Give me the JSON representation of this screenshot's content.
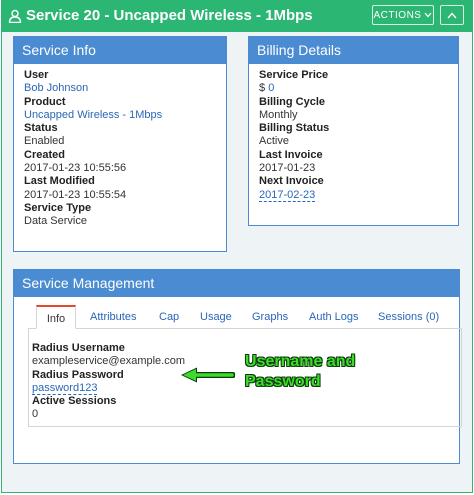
{
  "window": {
    "title": "Service 20 - Uncapped Wireless - 1Mbps",
    "actions_label": "ACTIONS",
    "accent_color": "#2bb673"
  },
  "service_info": {
    "heading": "Service Info",
    "fields": [
      {
        "label": "User",
        "value": "Bob Johnson"
      },
      {
        "label": "Product",
        "value": "Uncapped Wireless - 1Mbps"
      },
      {
        "label": "Status",
        "value": "Enabled"
      },
      {
        "label": "Created",
        "value": "2017-01-23 10:55:56"
      },
      {
        "label": "Last Modified",
        "value": "2017-01-23 10:55:54"
      },
      {
        "label": "Service Type",
        "value": "Data Service"
      }
    ]
  },
  "billing": {
    "heading": "Billing Details",
    "price_label": "Service Price",
    "price_currency": "$",
    "price_value": "0",
    "cycle_label": "Billing Cycle",
    "cycle_value": "Monthly",
    "status_label": "Billing Status",
    "status_value": "Active",
    "last_invoice_label": "Last Invoice",
    "last_invoice_value": "2017-01-23",
    "next_invoice_label": "Next Invoice",
    "next_invoice_value": "2017-02-23"
  },
  "management": {
    "heading": "Service Management",
    "tabs": [
      "Info",
      "Attributes",
      "Cap",
      "Usage",
      "Graphs",
      "Auth Logs",
      "Sessions (0)"
    ],
    "active_tab": "Info",
    "radius_username_label": "Radius Username",
    "radius_username_value": "exampleservice@example.com",
    "radius_password_label": "Radius Password",
    "radius_password_value": "password123",
    "active_sessions_label": "Active Sessions",
    "active_sessions_value": "0"
  },
  "annotation": {
    "line1": "Username and",
    "line2": "Password",
    "color": "#3ddc2a"
  },
  "panel_color": "#4a8bd1"
}
